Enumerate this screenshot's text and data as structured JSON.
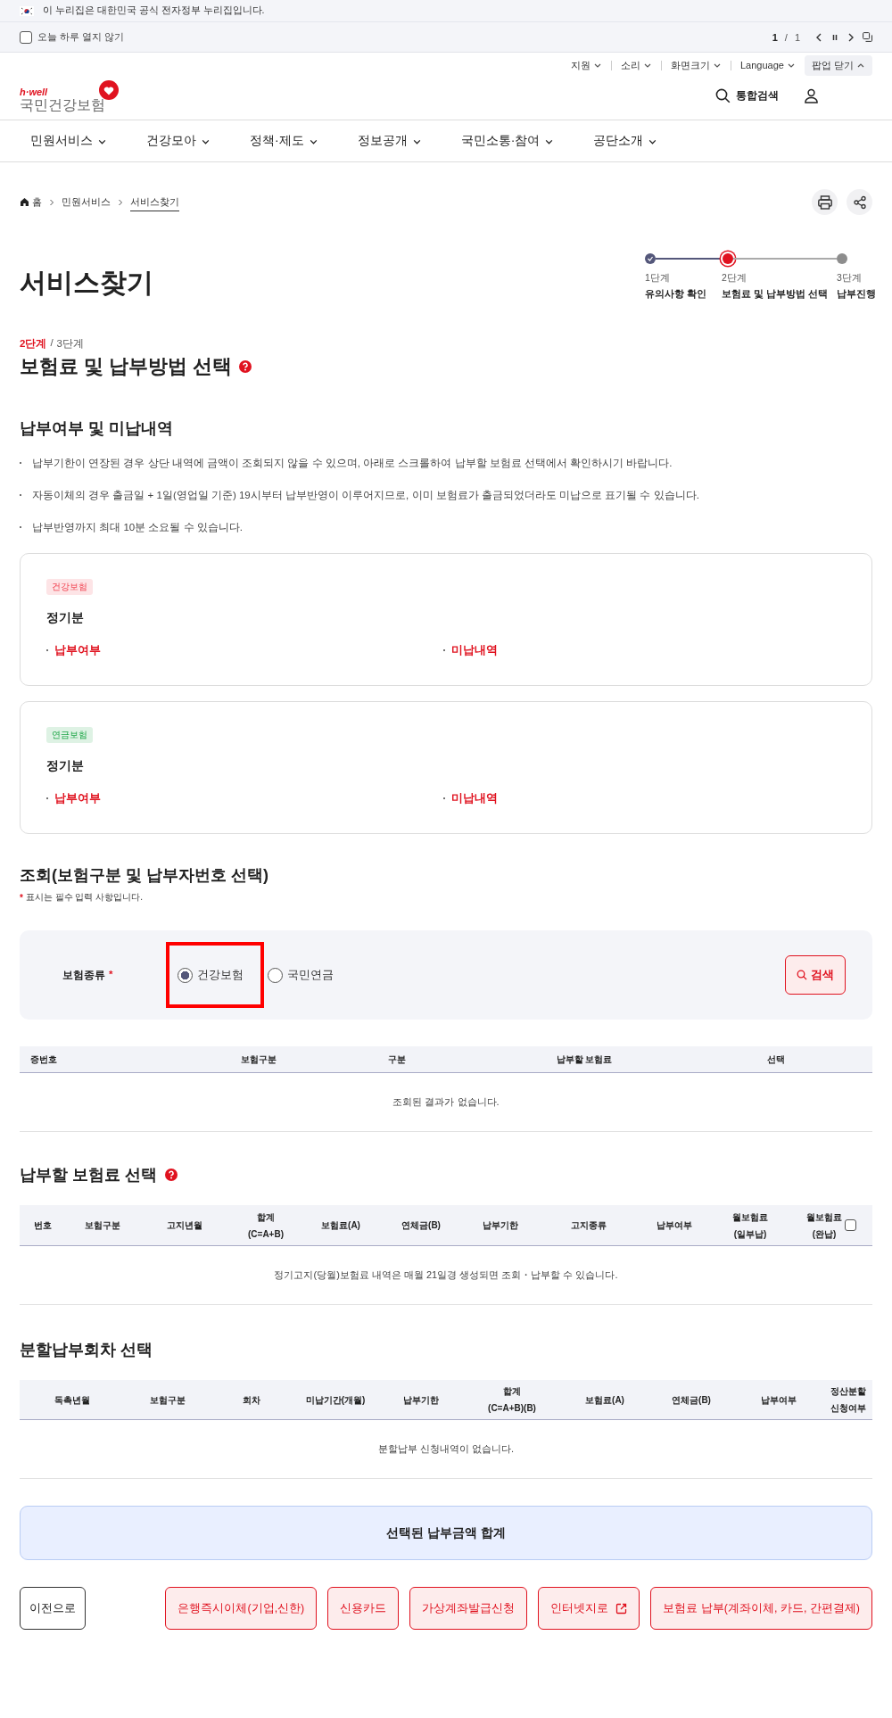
{
  "gov_banner": {
    "text": "이 누리집은 대한민국 공식 전자정부 누리집입니다."
  },
  "popup_bar": {
    "dont_show_today": {
      "label": "오늘 하루 열지 않기",
      "checked": false
    },
    "page": "1",
    "separator": "/",
    "total": "1"
  },
  "utility_menu": [
    {
      "label": "지원",
      "expanded": false
    },
    {
      "label": "소리",
      "expanded": false
    },
    {
      "label": "화면크기",
      "expanded": false
    },
    {
      "label": "Language",
      "expanded": false
    },
    {
      "label": "팝업 닫기",
      "expanded": true
    }
  ],
  "logo": {
    "tagline": "h·well",
    "name": "국민건강보험"
  },
  "header_search": "통합검색",
  "nav": [
    "민원서비스",
    "건강모아",
    "정책·제도",
    "정보공개",
    "국민소통·참여",
    "공단소개"
  ],
  "breadcrumb": [
    {
      "label": "홈",
      "selected": false
    },
    {
      "label": "민원서비스",
      "selected": false
    },
    {
      "label": "서비스찾기",
      "selected": true
    }
  ],
  "page_title": "서비스찾기",
  "steps": [
    {
      "number": "1단계",
      "label": "유의사항 확인",
      "completed": true,
      "selected": false
    },
    {
      "number": "2단계",
      "label": "보험료 및 납부방법 선택",
      "completed": false,
      "selected": true
    },
    {
      "number": "3단계",
      "label": "납부진행",
      "completed": false,
      "selected": false
    }
  ],
  "step_heading": {
    "current": "2단계",
    "separator": "/",
    "total": "3단계",
    "title": "보험료 및 납부방법 선택",
    "help": true
  },
  "payment_status": {
    "title": "납부여부 및 미납내역",
    "notes": [
      "납부기한이 연장된 경우 상단 내역에 금액이 조회되지 않을 수 있으며, 아래로 스크롤하여 납부할 보험료 선택에서 확인하시기 바랍니다.",
      "자동이체의 경우 출금일 + 1일(영업일 기준) 19시부터 납부반영이 이루어지므로, 이미 보험료가 출금되었더라도 미납으로 표기될 수 있습니다.",
      "납부반영까지 최대 10분 소요될 수 있습니다."
    ],
    "cards": [
      {
        "tag": "건강보험",
        "color": "#fde4e6",
        "period": "정기분",
        "fields": [
          "납부여부",
          "미납내역"
        ]
      },
      {
        "tag": "연금보험",
        "color": "#def2e4",
        "period": "정기분",
        "fields": [
          "납부여부",
          "미납내역"
        ]
      }
    ]
  },
  "lookup": {
    "title": "조회(보험구분 및 납부자번호 선택)",
    "required_mark": "*",
    "required_note": "표시는 필수 입력 사항입니다.",
    "field_label": "보험종류",
    "field_required_mark": "*",
    "options": [
      {
        "label": "건강보험",
        "selected": true,
        "highlighted": true
      },
      {
        "label": "국민연금",
        "selected": false,
        "highlighted": false
      }
    ],
    "search_button": "검색",
    "columns": [
      "증번호",
      "보험구분",
      "구분",
      "납부할 보험료",
      "선택"
    ],
    "empty_message": "조회된 결과가 없습니다."
  },
  "premium_select": {
    "title": "납부할 보험료 선택",
    "help": true,
    "columns": [
      {
        "label": "번호"
      },
      {
        "label": "보험구분"
      },
      {
        "label": "고지년월"
      },
      {
        "label": "합계\n(C=A+B)"
      },
      {
        "label": "보험료(A)"
      },
      {
        "label": "연체금(B)"
      },
      {
        "label": "납부기한"
      },
      {
        "label": "고지종류"
      },
      {
        "label": "납부여부"
      },
      {
        "label": "월보험료\n(일부납)"
      },
      {
        "label": "월보험료\n(완납)",
        "checked": false
      }
    ],
    "empty_message": "정기고지(당월)보험료 내역은 매월 21일경 생성되면 조회・납부할 수 있습니다."
  },
  "installment": {
    "title": "분할납부회차 선택",
    "columns": [
      "독촉년월",
      "보험구분",
      "회차",
      "미납기간(개월)",
      "납부기한",
      "합계\n(C=A+B)(B)",
      "보험료(A)",
      "연체금(B)",
      "납부여부",
      "정산분할\n신청여부"
    ],
    "empty_message": "분할납부 신청내역이 없습니다."
  },
  "total_bar": "선택된 납부금액 합계",
  "buttons": [
    {
      "label": "이전으로",
      "kind": "secondary"
    },
    {
      "label": "은행즉시이체(기업,신한)",
      "kind": "primary"
    },
    {
      "label": "신용카드",
      "kind": "primary"
    },
    {
      "label": "가상계좌발급신청",
      "kind": "primary"
    },
    {
      "label": "인터넷지로",
      "kind": "external"
    },
    {
      "label": "보험료 납부(계좌이체, 카드, 간편결제)",
      "kind": "primary"
    }
  ]
}
